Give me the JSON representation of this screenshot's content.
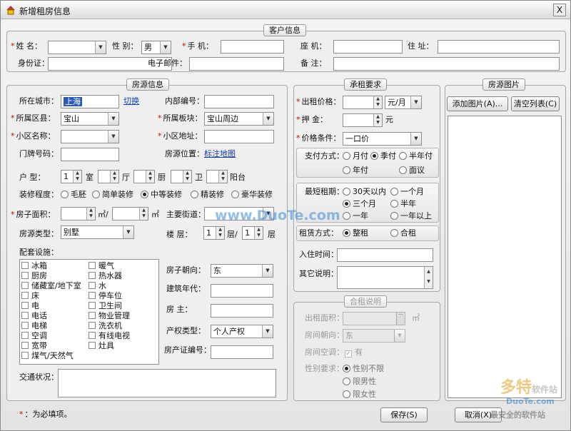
{
  "window": {
    "title": "新增租房信息",
    "close": "X"
  },
  "customer": {
    "title": "客户信息",
    "name_label": "姓  名：",
    "gender_label": "性  别：",
    "gender_value": "男",
    "mobile_label": "手  机：",
    "landline_label": "座  机：",
    "address_label": "住  址：",
    "id_label": "身份证：",
    "email_label": "电子邮件：",
    "note_label": "备  注："
  },
  "house": {
    "title": "房源信息",
    "city_label": "所在城市：",
    "city_value": "上海",
    "switch_link": "切换",
    "internal_no_label": "内部编号：",
    "district_label": "所属区县：",
    "district_value": "宝山",
    "block_label": "所属板块：",
    "block_value": "宝山周边",
    "community_label": "小区名称：",
    "community_address_label": "小区地址：",
    "doorplate_label": "门牌号码：",
    "position_label": "房源位置：",
    "map_link": "标注地图",
    "layout_label": "户    型：",
    "room_value": "1",
    "room_unit": "室",
    "hall_unit": "厅",
    "kitchen_unit": "厨",
    "bath_unit": "卫",
    "balcony_unit": "阳台",
    "decor_label": "装修程度：",
    "decor_options": [
      "毛胚",
      "简单装修",
      "中等装修",
      "精装修",
      "豪华装修"
    ],
    "decor_selected": 2,
    "area_label": "房子面积：",
    "area_unit": "㎡/",
    "area_unit2": "㎡",
    "street_label": "主要街道：",
    "type_label": "房源类型：",
    "type_value": "别墅",
    "floor_label": "楼    层：",
    "floor_value": "1",
    "floor_sep": "层/",
    "total_floor_value": "1",
    "floor_unit": "层",
    "facilities_label": "配套设施：",
    "facilities_col1": [
      "冰箱",
      "厨房",
      "储藏室/地下室",
      "床",
      "电",
      "电话",
      "电梯",
      "空调",
      "宽带",
      "煤气/天然气"
    ],
    "facilities_col2": [
      "暖气",
      "热水器",
      "水",
      "停车位",
      "卫生间",
      "物业管理",
      "洗衣机",
      "有线电视",
      "灶具"
    ],
    "orientation_label": "房子朝向：",
    "orientation_value": "东",
    "year_label": "建筑年代：",
    "owner_label": "房    主：",
    "property_label": "产权类型：",
    "property_value": "个人产权",
    "cert_label": "房产证编号：",
    "traffic_label": "交通状况："
  },
  "rent": {
    "title": "承租要求",
    "price_label": "出租价格：",
    "price_unit": "元/月",
    "deposit_label": "押    金：",
    "deposit_unit": "元",
    "condition_label": "价格条件：",
    "condition_value": "一口价",
    "pay_label": "支付方式：",
    "pay_options": [
      "月付",
      "季付",
      "半年付",
      "年付",
      "面议"
    ],
    "pay_selected": 1,
    "min_label": "最短租期：",
    "min_options": [
      "30天以内",
      "一个月",
      "三个月",
      "半年",
      "一年",
      "一年以上"
    ],
    "min_selected": 2,
    "mode_label": "租赁方式：",
    "mode_options": [
      "整租",
      "合租"
    ],
    "mode_selected": 0,
    "checkin_label": "入住时间：",
    "other_label": "其它说明："
  },
  "share": {
    "title": "合租说明",
    "area_label": "出租面积：",
    "area_unit": "㎡",
    "room_orient_label": "房间朝向：",
    "room_orient_value": "东",
    "room_ac_label": "房间空调：",
    "room_ac_value": "有",
    "gender_label": "性别要求：",
    "gender_options": [
      "性别不限",
      "限男性",
      "限女性"
    ],
    "gender_selected": 0
  },
  "photos": {
    "title": "房源图片",
    "add_button": "添加图片(A)...",
    "clear_button": "清空列表(C)"
  },
  "footer": {
    "required_mark": "*",
    "required_note": "：为必填项。",
    "save_button": "保存(S)",
    "cancel_button": "取消(X)"
  },
  "watermark": {
    "top": "www.DuoTe.com",
    "brand": "多特",
    "brand_sub": "软件站",
    "bottom": "DuoTe.com",
    "tagline": "最安全的软件站"
  },
  "colors": {
    "required": "#d40000",
    "link": "#1040b0",
    "selection": "#2d5ab9"
  }
}
